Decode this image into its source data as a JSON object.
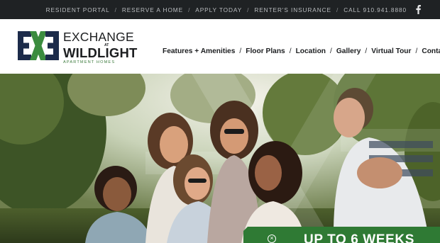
{
  "topbar": {
    "links": [
      "RESIDENT PORTAL",
      "RESERVE A HOME",
      "APPLY TODAY",
      "RENTER'S INSURANCE",
      "CALL 910.941.8880"
    ],
    "separator": "/",
    "social_icon": "facebook-icon"
  },
  "logo": {
    "line1": "EXCHANGE",
    "at": "AT",
    "line2": "WILDLIGHT",
    "tagline": "APARTMENT HOMES",
    "colors": {
      "navy": "#1c2b4a",
      "green": "#3b8c3f"
    }
  },
  "nav": {
    "items": [
      "Features + Amenities",
      "Floor Plans",
      "Location",
      "Gallery",
      "Virtual Tour",
      "Contact"
    ],
    "separator": "/"
  },
  "hero": {
    "image": "group of smiling young friends sitting outdoors among trees"
  },
  "promo": {
    "text": "UP TO 6 WEEKS",
    "close_icon": "close-icon",
    "color": "#2f7a34"
  }
}
